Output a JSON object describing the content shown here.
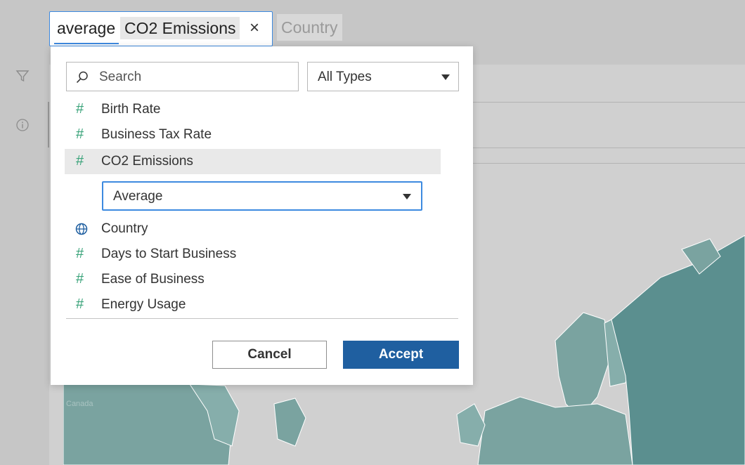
{
  "query": {
    "text": "average",
    "field_chip": "CO2 Emissions",
    "next_chip": "Country"
  },
  "sidebar": {
    "icons": [
      "filter-icon",
      "info-icon"
    ]
  },
  "search": {
    "placeholder": "Search",
    "value": ""
  },
  "type_filter": {
    "selected": "All Types"
  },
  "fields": [
    {
      "label": "Birth Rate",
      "icon": "hash-icon"
    },
    {
      "label": "Business Tax Rate",
      "icon": "hash-icon"
    },
    {
      "label": "CO2 Emissions",
      "icon": "hash-icon",
      "selected": true
    },
    {
      "label": "Country",
      "icon": "globe-icon"
    },
    {
      "label": "Days to Start Business",
      "icon": "hash-icon"
    },
    {
      "label": "Ease of Business",
      "icon": "hash-icon"
    },
    {
      "label": "Energy Usage",
      "icon": "hash-icon"
    }
  ],
  "aggregation": {
    "selected": "Average"
  },
  "buttons": {
    "cancel": "Cancel",
    "accept": "Accept"
  },
  "map": {
    "label": "Canada"
  },
  "colors": {
    "accent": "#3d8ae0",
    "accept": "#1f5fa0",
    "measure_icon": "#3aa37a",
    "dimension_icon": "#1f5fa0",
    "map_fill": "#7aa3a0",
    "map_highlight": "#5b8f8f"
  }
}
